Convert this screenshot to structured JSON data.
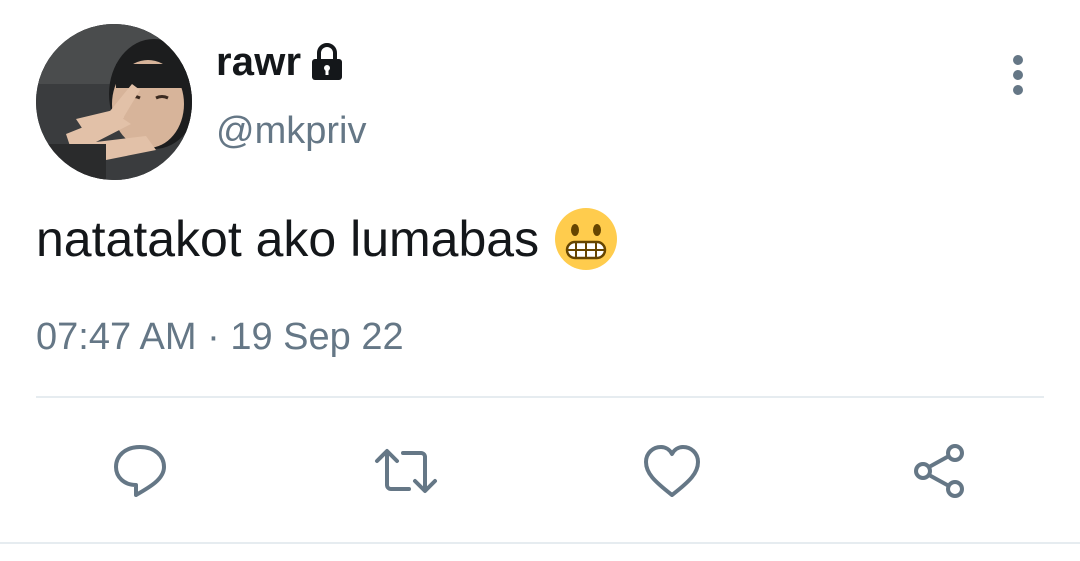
{
  "tweet": {
    "display_name": "rawr",
    "handle": "@mkpriv",
    "text": "natatakot ako lumabas",
    "timestamp": "07:47 AM · 19 Sep 22",
    "emoji": "grimacing-face"
  },
  "icons": {
    "lock": "lock-icon",
    "more": "more-vertical-icon",
    "reply": "reply-icon",
    "retweet": "retweet-icon",
    "like": "heart-icon",
    "share": "share-icon"
  },
  "colors": {
    "text_primary": "#14171a",
    "text_secondary": "#657786",
    "divider": "#e6ecf0",
    "emoji_yellow": "#ffcc4d"
  }
}
